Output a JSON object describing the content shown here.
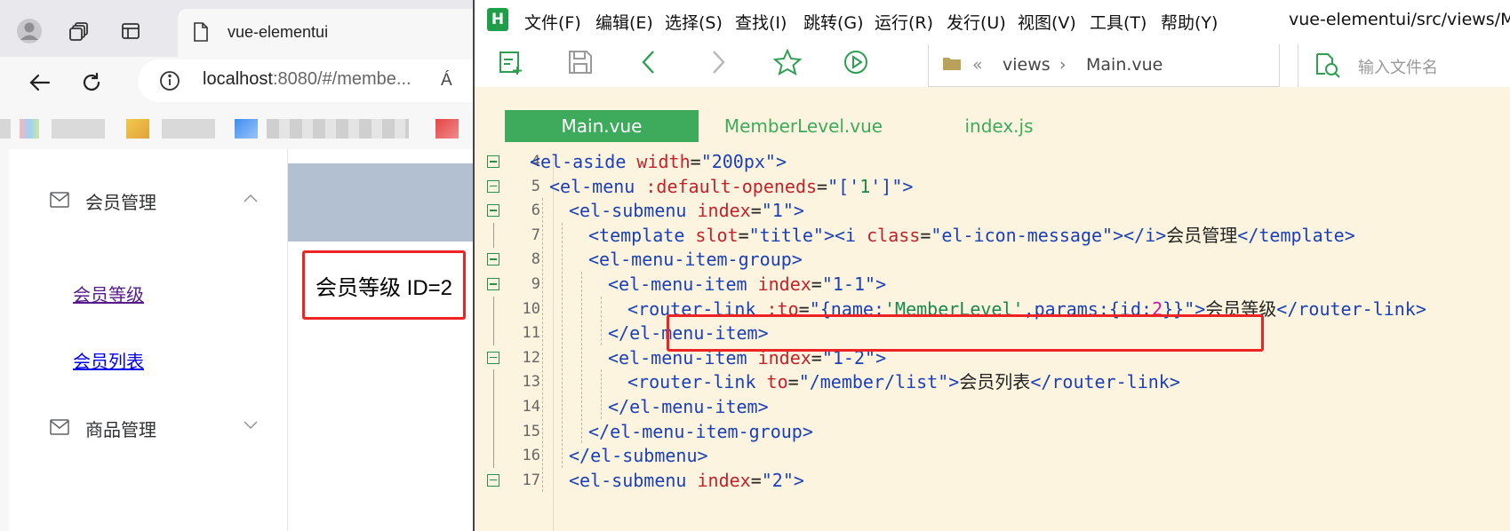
{
  "browser": {
    "tab_title": "vue-elementui",
    "address_host": "localhost",
    "address_rest": ":8080/#/membe...",
    "reader_label": "Á",
    "sidebar": {
      "group1_title": "会员管理",
      "group1_items": [
        "会员等级",
        "会员列表"
      ],
      "group2_title": "商品管理"
    },
    "result_text": "会员等级 ID=2"
  },
  "editor": {
    "logo": "H",
    "menu": [
      "文件(F)",
      "编辑(E)",
      "选择(S)",
      "查找(I)",
      "跳转(G)",
      "运行(R)",
      "发行(U)",
      "视图(V)",
      "工具(T)",
      "帮助(Y)"
    ],
    "path": "vue-elementui/src/views/Mai",
    "breadcrumb": {
      "folder": "views",
      "file": "Main.vue"
    },
    "file_search_placeholder": "输入文件名",
    "tabs": [
      "Main.vue",
      "MemberLevel.vue",
      "index.js"
    ],
    "active_tab": "Main.vue",
    "code_lines": [
      {
        "num": "4",
        "fold": true,
        "segs": [
          [
            "tg",
            "<el-aside "
          ],
          [
            "at",
            "width"
          ],
          [
            "eq",
            "="
          ],
          [
            "sv",
            "\"200px\""
          ],
          [
            "tg",
            ">"
          ]
        ]
      },
      {
        "num": "5",
        "fold": true,
        "segs": [
          [
            "tg",
            "<el-menu "
          ],
          [
            "at",
            ":default-openeds"
          ],
          [
            "eq",
            "="
          ],
          [
            "sv",
            "\"['"
          ],
          [
            "tl",
            "1"
          ],
          [
            "sv",
            "']\""
          ],
          [
            "tg",
            ">"
          ]
        ]
      },
      {
        "num": "6",
        "fold": true,
        "segs": [
          [
            "tg",
            "<el-submenu "
          ],
          [
            "at",
            "index"
          ],
          [
            "eq",
            "="
          ],
          [
            "sv",
            "\"1\""
          ],
          [
            "tg",
            ">"
          ]
        ]
      },
      {
        "num": "7",
        "fold": false,
        "segs": [
          [
            "tg",
            "<template "
          ],
          [
            "at",
            "slot"
          ],
          [
            "eq",
            "="
          ],
          [
            "sv",
            "\"title\""
          ],
          [
            "tg",
            "><i "
          ],
          [
            "at",
            "class"
          ],
          [
            "eq",
            "="
          ],
          [
            "sv",
            "\"el-icon-message\""
          ],
          [
            "tg",
            "></i>"
          ],
          [
            "tx",
            "会员管理"
          ],
          [
            "tg",
            "</template>"
          ]
        ]
      },
      {
        "num": "8",
        "fold": true,
        "segs": [
          [
            "tg",
            "<el-menu-item-group>"
          ]
        ]
      },
      {
        "num": "9",
        "fold": true,
        "segs": [
          [
            "tg",
            "<el-menu-item "
          ],
          [
            "at",
            "index"
          ],
          [
            "eq",
            "="
          ],
          [
            "sv",
            "\"1-1\""
          ],
          [
            "tg",
            ">"
          ]
        ]
      },
      {
        "num": "10",
        "fold": false,
        "segs": [
          [
            "tg",
            "<router-link "
          ],
          [
            "at",
            ":to"
          ],
          [
            "eq",
            "="
          ],
          [
            "sv",
            "\"{name:"
          ],
          [
            "tl",
            "'MemberLevel'"
          ],
          [
            "sv",
            ",params:{id:"
          ],
          [
            "nm",
            "2"
          ],
          [
            "sv",
            "}}\""
          ],
          [
            "tg",
            ">"
          ],
          [
            "tx",
            "会员等级"
          ],
          [
            "tg",
            "</router-link>"
          ]
        ]
      },
      {
        "num": "11",
        "fold": false,
        "segs": [
          [
            "tg",
            "</el-menu-item>"
          ]
        ]
      },
      {
        "num": "12",
        "fold": true,
        "segs": [
          [
            "tg",
            "<el-menu-item "
          ],
          [
            "at",
            "index"
          ],
          [
            "eq",
            "="
          ],
          [
            "sv",
            "\"1-2\""
          ],
          [
            "tg",
            ">"
          ]
        ]
      },
      {
        "num": "13",
        "fold": false,
        "segs": [
          [
            "tg",
            "<router-link "
          ],
          [
            "at",
            "to"
          ],
          [
            "eq",
            "="
          ],
          [
            "sv",
            "\"/member/list\""
          ],
          [
            "tg",
            ">"
          ],
          [
            "tx",
            "会员列表"
          ],
          [
            "tg",
            "</router-link>"
          ]
        ]
      },
      {
        "num": "14",
        "fold": false,
        "segs": [
          [
            "tg",
            "</el-menu-item>"
          ]
        ]
      },
      {
        "num": "15",
        "fold": false,
        "segs": [
          [
            "tg",
            "</el-menu-item-group>"
          ]
        ]
      },
      {
        "num": "16",
        "fold": false,
        "segs": [
          [
            "tg",
            "</el-submenu>"
          ]
        ]
      },
      {
        "num": "17",
        "fold": true,
        "segs": [
          [
            "tg",
            "<el-submenu "
          ],
          [
            "at",
            "index"
          ],
          [
            "eq",
            "="
          ],
          [
            "sv",
            "\"2\""
          ],
          [
            "tg",
            ">"
          ]
        ]
      }
    ]
  },
  "colors": {
    "highlight_border": "#ee2424",
    "editor_bg": "#fcf4de",
    "accent_green": "#3daa5c",
    "header_bar": "#b3c0d1",
    "link_visited": "#551a8b",
    "link": "#0000ee"
  }
}
